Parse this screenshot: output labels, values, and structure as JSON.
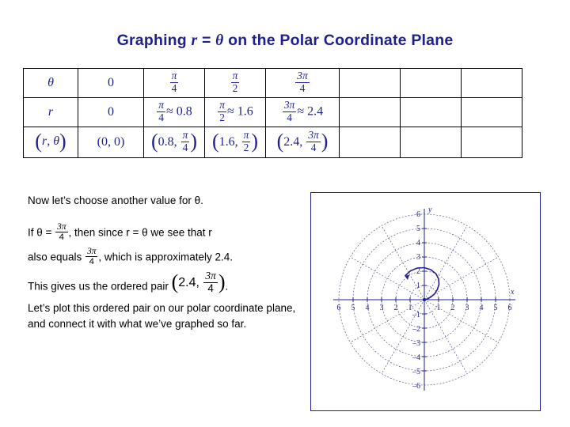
{
  "title": {
    "before": "Graphing ",
    "r": "r",
    "eq": " = ",
    "theta": "θ",
    "after": " on the Polar Coordinate Plane"
  },
  "table": {
    "row_labels": [
      "θ",
      "r",
      "(r, θ)"
    ],
    "theta_row": [
      {
        "type": "plain",
        "text": "0"
      },
      {
        "type": "frac",
        "num": "π",
        "den": "4"
      },
      {
        "type": "frac",
        "num": "π",
        "den": "2"
      },
      {
        "type": "frac",
        "num": "3π",
        "den": "4"
      },
      {
        "type": "empty",
        "text": ""
      },
      {
        "type": "empty",
        "text": ""
      },
      {
        "type": "empty",
        "text": ""
      }
    ],
    "r_row": [
      {
        "type": "plain",
        "text": "0"
      },
      {
        "type": "approx",
        "num": "π",
        "den": "4",
        "approx": "≈ 0.8"
      },
      {
        "type": "approx",
        "num": "π",
        "den": "2",
        "approx": "≈ 1.6"
      },
      {
        "type": "approx",
        "num": "3π",
        "den": "4",
        "approx": "≈ 2.4"
      },
      {
        "type": "empty",
        "text": ""
      },
      {
        "type": "empty",
        "text": ""
      },
      {
        "type": "empty",
        "text": ""
      }
    ],
    "pair_row": [
      {
        "type": "pair_plain",
        "text": "(0, 0)"
      },
      {
        "type": "pair_frac",
        "first": "0.8,",
        "num": "π",
        "den": "4"
      },
      {
        "type": "pair_frac",
        "first": "1.6,",
        "num": "π",
        "den": "2"
      },
      {
        "type": "pair_frac",
        "first": "2.4,",
        "num": "3π",
        "den": "4"
      },
      {
        "type": "empty",
        "text": ""
      },
      {
        "type": "empty",
        "text": ""
      },
      {
        "type": "empty",
        "text": ""
      }
    ]
  },
  "body": {
    "p1": "Now let’s choose another value for θ.",
    "p2_a": "If θ = ",
    "p2_frac_num": "3π",
    "p2_frac_den": "4",
    "p2_b": ", then since r = θ we see that r",
    "p3_a": "also equals ",
    "p3_frac_num": "3π",
    "p3_frac_den": "4",
    "p3_b": ", which is approximately 2.4.",
    "p4_a": "This gives us the ordered pair ",
    "p4_pair_first": "2.4,",
    "p4_frac_num": "3π",
    "p4_frac_den": "4",
    "p4_b": ".",
    "p5": "Let’s plot this ordered pair on our polar coordinate plane, and connect it with what we’ve graphed so far."
  },
  "graph": {
    "x_axis_label": "x",
    "y_axis_label": "y",
    "x_ticks_left": [
      "6",
      "5",
      "4",
      "3",
      "2",
      "1"
    ],
    "x_ticks_right": [
      "1",
      "2",
      "3",
      "4",
      "5",
      "6"
    ],
    "y_ticks_top": [
      "6",
      "5",
      "4",
      "3",
      "2",
      "1"
    ],
    "y_ticks_bottom": [
      "–1",
      "–2",
      "–3",
      "–4",
      "–5",
      "–6"
    ],
    "colors": {
      "axes": "#1f1f8f",
      "grid": "#5a5a8c",
      "curve": "#1f1f8f",
      "frame": "#1f1f8f"
    }
  }
}
